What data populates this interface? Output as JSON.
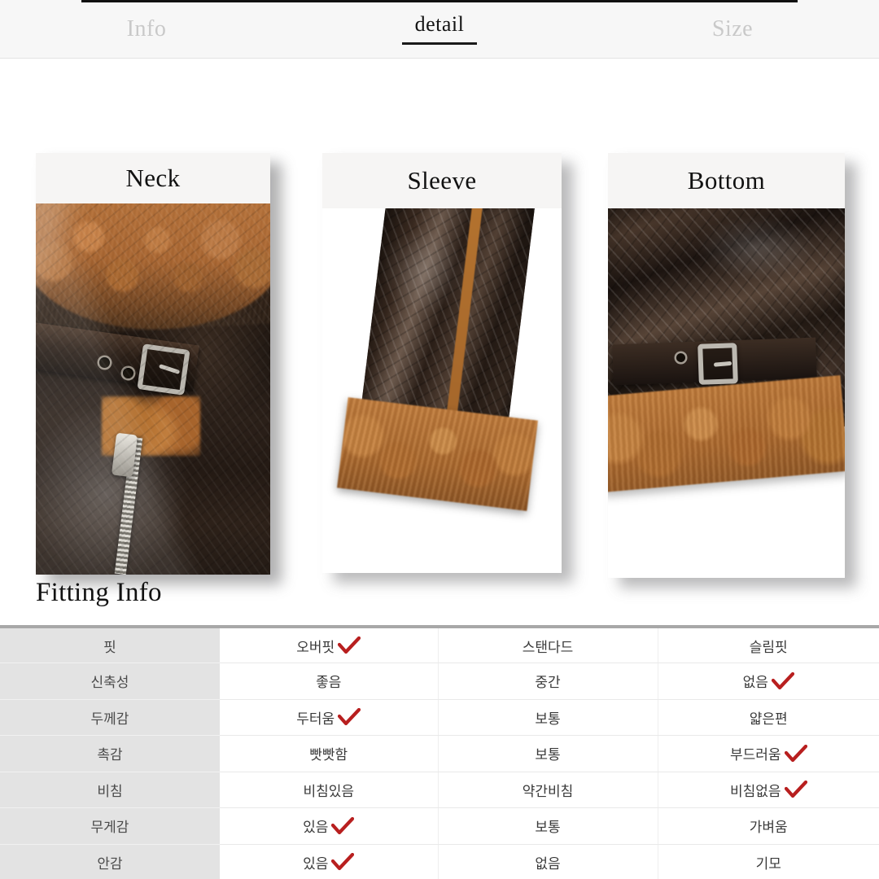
{
  "tabs": [
    {
      "label": "Info",
      "active": false
    },
    {
      "label": "detail",
      "active": true
    },
    {
      "label": "Size",
      "active": false
    }
  ],
  "detail_cards": [
    {
      "caption": "Neck",
      "image_alt": "brown leather jacket collar with shearling fur, belt strap, silver buckle and zipper"
    },
    {
      "caption": "Sleeve",
      "image_alt": "leather jacket sleeve cuff with brown shearling fur trim"
    },
    {
      "caption": "Bottom",
      "image_alt": "leather jacket hem with belt buckle and brown shearling fur trim"
    }
  ],
  "fitting": {
    "title": "Fitting Info",
    "check_color": "#b81f1f",
    "rows": [
      {
        "label": "핏",
        "options": [
          {
            "text": "오버핏",
            "checked": true
          },
          {
            "text": "스탠다드",
            "checked": false
          },
          {
            "text": "슬림핏",
            "checked": false
          }
        ]
      },
      {
        "label": "신축성",
        "options": [
          {
            "text": "좋음",
            "checked": false
          },
          {
            "text": "중간",
            "checked": false
          },
          {
            "text": "없음",
            "checked": true
          }
        ]
      },
      {
        "label": "두께감",
        "options": [
          {
            "text": "두터움",
            "checked": true
          },
          {
            "text": "보통",
            "checked": false
          },
          {
            "text": "얇은편",
            "checked": false
          }
        ]
      },
      {
        "label": "촉감",
        "options": [
          {
            "text": "빳빳함",
            "checked": false
          },
          {
            "text": "보통",
            "checked": false
          },
          {
            "text": "부드러움",
            "checked": true
          }
        ]
      },
      {
        "label": "비침",
        "options": [
          {
            "text": "비침있음",
            "checked": false
          },
          {
            "text": "약간비침",
            "checked": false
          },
          {
            "text": "비침없음",
            "checked": true
          }
        ]
      },
      {
        "label": "무게감",
        "options": [
          {
            "text": "있음",
            "checked": true
          },
          {
            "text": "보통",
            "checked": false
          },
          {
            "text": "가벼움",
            "checked": false
          }
        ]
      },
      {
        "label": "안감",
        "options": [
          {
            "text": "있음",
            "checked": true
          },
          {
            "text": "없음",
            "checked": false
          },
          {
            "text": "기모",
            "checked": false
          }
        ]
      }
    ]
  }
}
